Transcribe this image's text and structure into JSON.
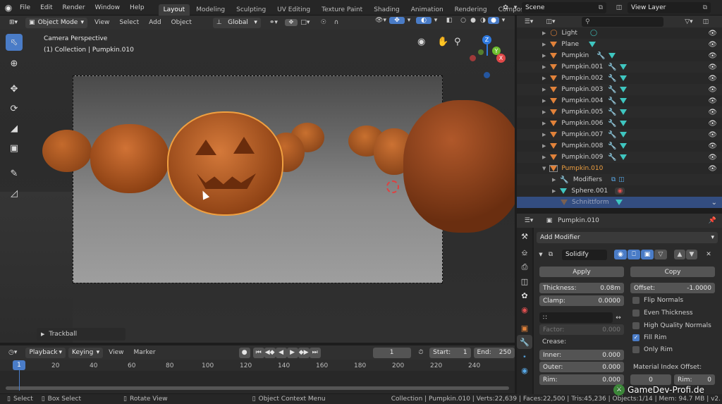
{
  "menu": {
    "items": [
      "File",
      "Edit",
      "Render",
      "Window",
      "Help"
    ]
  },
  "workspaces": [
    "Layout",
    "Modeling",
    "Sculpting",
    "UV Editing",
    "Texture Paint",
    "Shading",
    "Animation",
    "Rendering",
    "Compositing"
  ],
  "scene": {
    "label": "Scene",
    "view_layer": "View Layer"
  },
  "viewport": {
    "mode": "Object Mode",
    "menus": [
      "View",
      "Select",
      "Add",
      "Object"
    ],
    "orientation": "Global",
    "overlay_title": "Camera Perspective",
    "overlay_sub": "(1) Collection | Pumpkin.010",
    "gizmo": {
      "z": "Z",
      "y": "Y",
      "x": "X"
    },
    "last_op": "Trackball"
  },
  "outliner": {
    "items": [
      {
        "name": "Light",
        "type": "light"
      },
      {
        "name": "Plane",
        "type": "mesh"
      },
      {
        "name": "Pumpkin",
        "type": "mesh",
        "mod": true
      },
      {
        "name": "Pumpkin.001",
        "type": "mesh",
        "mod": true
      },
      {
        "name": "Pumpkin.002",
        "type": "mesh",
        "mod": true
      },
      {
        "name": "Pumpkin.003",
        "type": "mesh",
        "mod": true
      },
      {
        "name": "Pumpkin.004",
        "type": "mesh",
        "mod": true
      },
      {
        "name": "Pumpkin.005",
        "type": "mesh",
        "mod": true
      },
      {
        "name": "Pumpkin.006",
        "type": "mesh",
        "mod": true
      },
      {
        "name": "Pumpkin.007",
        "type": "mesh",
        "mod": true
      },
      {
        "name": "Pumpkin.008",
        "type": "mesh",
        "mod": true
      },
      {
        "name": "Pumpkin.009",
        "type": "mesh",
        "mod": true
      },
      {
        "name": "Pumpkin.010",
        "type": "mesh",
        "active": true
      },
      {
        "name": "Modifiers",
        "type": "child"
      },
      {
        "name": "Sphere.001",
        "type": "child"
      },
      {
        "name": "Schnittform",
        "type": "child",
        "selected": true
      }
    ]
  },
  "properties": {
    "object": "Pumpkin.010",
    "add_modifier": "Add Modifier",
    "modifier_name": "Solidify",
    "apply": "Apply",
    "copy": "Copy",
    "thickness_label": "Thickness:",
    "thickness": "0.08m",
    "offset_label": "Offset:",
    "offset": "-1.0000",
    "clamp_label": "Clamp:",
    "clamp": "0.0000",
    "flip_normals": "Flip Normals",
    "even_thickness": "Even Thickness",
    "high_quality": "High Quality Normals",
    "fill_rim": "Fill Rim",
    "only_rim": "Only Rim",
    "factor_label": "Factor:",
    "factor": "0.000",
    "crease": "Crease:",
    "inner_label": "Inner:",
    "inner": "0.000",
    "outer_label": "Outer:",
    "outer": "0.000",
    "rim_label": "Rim:",
    "rim": "0.000",
    "mat_offset": "Material Index Offset:",
    "mat_val": "0",
    "mat_rim_label": "Rim:",
    "mat_rim": "0"
  },
  "timeline": {
    "menus": [
      "Playback",
      "Keying",
      "View",
      "Marker"
    ],
    "current": "1",
    "start_label": "Start:",
    "start": "1",
    "end_label": "End:",
    "end": "250",
    "ticks": [
      "1",
      "20",
      "40",
      "60",
      "80",
      "100",
      "120",
      "140",
      "160",
      "180",
      "200",
      "220",
      "240"
    ]
  },
  "status": {
    "select": "Select",
    "box_select": "Box Select",
    "rotate": "Rotate View",
    "context": "Object Context Menu",
    "stats": "Collection | Pumpkin.010 | Verts:22,639 | Faces:22,500 | Tris:45,236 | Objects:1/14 | Mem: 94.7 MB | v2.",
    "watermark": "GameDev-Profi.de"
  },
  "colors": {
    "accent": "#4a7cc7",
    "orange": "#e1823a",
    "teal": "#3fc6c0",
    "selected_row": "#334d80"
  }
}
